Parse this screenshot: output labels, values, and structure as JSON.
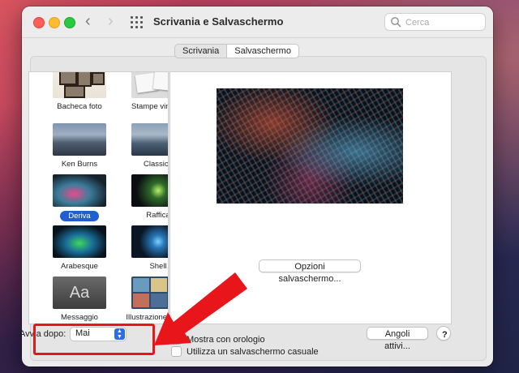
{
  "window": {
    "title": "Scrivania e Salvaschermo",
    "search_placeholder": "Cerca"
  },
  "tabs": [
    {
      "label": "Scrivania",
      "active": false
    },
    {
      "label": "Salvaschermo",
      "active": true
    }
  ],
  "screensavers": [
    {
      "label": "Bacheca foto",
      "selected": false
    },
    {
      "label": "Stampe vintage",
      "selected": false
    },
    {
      "label": "Ken Burns",
      "selected": false
    },
    {
      "label": "Classico",
      "selected": false
    },
    {
      "label": "Deriva",
      "selected": true
    },
    {
      "label": "Raffica",
      "selected": false
    },
    {
      "label": "Arabesque",
      "selected": false
    },
    {
      "label": "Shell",
      "selected": false
    },
    {
      "label": "Messaggio",
      "selected": false,
      "thumb_text": "Aa"
    },
    {
      "label": "Illustrazione album",
      "selected": false
    }
  ],
  "preview": {
    "options_button": "Opzioni salvaschermo..."
  },
  "footer": {
    "start_after_label": "Avvia dopo:",
    "start_after_value": "Mai",
    "show_clock_label": "Mostra con orologio",
    "show_clock_checked": false,
    "random_label": "Utilizza un salvaschermo casuale",
    "random_checked": false,
    "hot_corners_button": "Angoli attivi...",
    "help_button": "?"
  },
  "annotation": {
    "highlight_color": "#e8151b",
    "arrow_color": "#e8151b"
  },
  "colors": {
    "selection_blue": "#1f5fcf",
    "stepper_blue": "#2d6fe0"
  }
}
